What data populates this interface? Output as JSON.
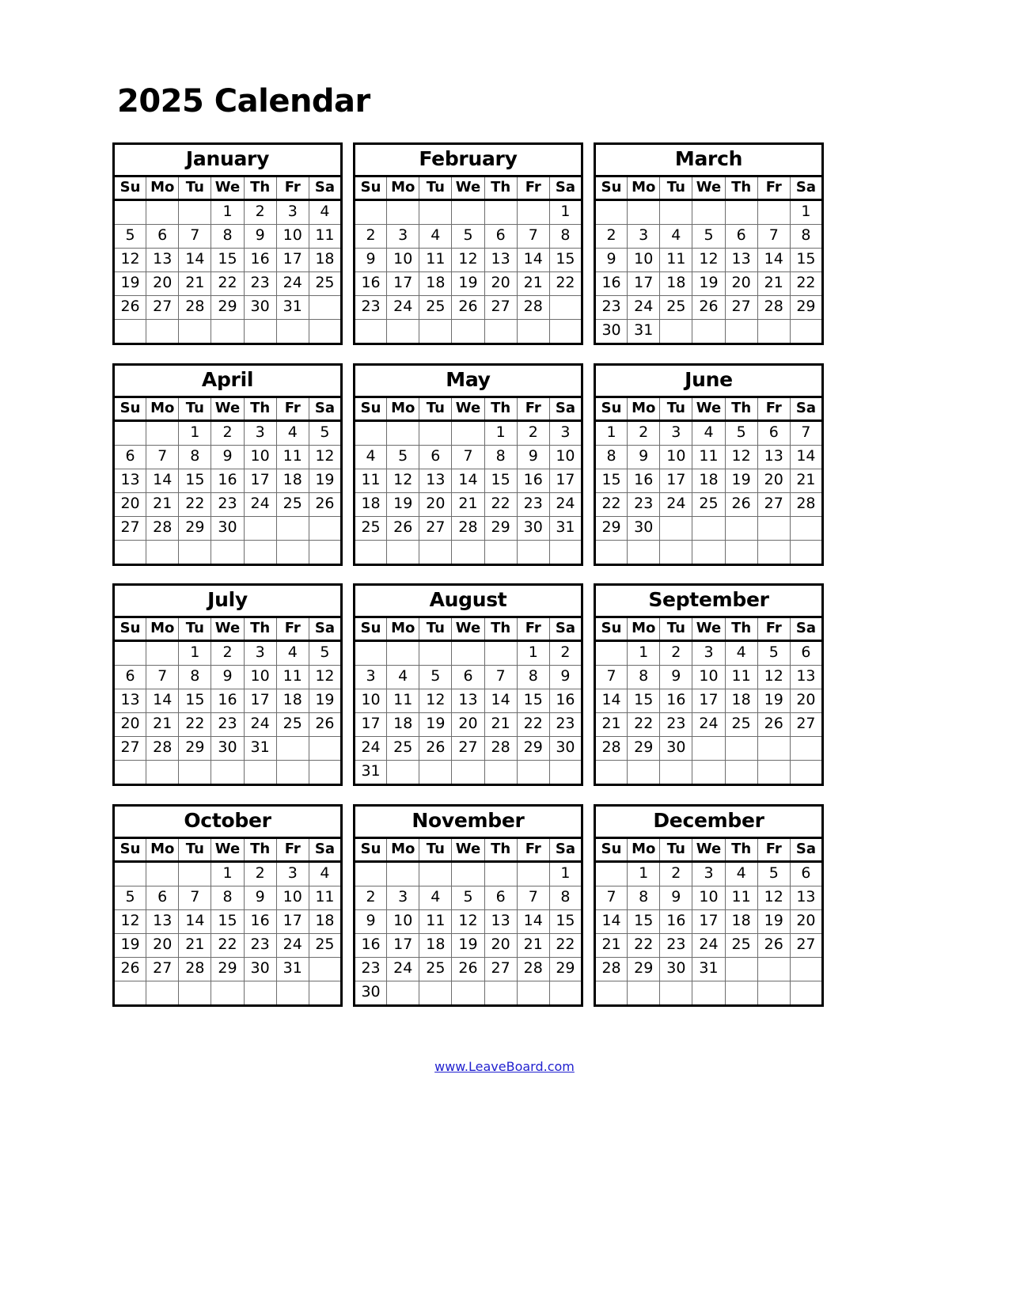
{
  "title": "2025 Calendar",
  "year": 2025,
  "footer": {
    "link_text": "www.LeaveBoard.com"
  },
  "colors": {
    "link": "#2121cf",
    "border_outer": "#000000",
    "border_inner": "#6d6d6d",
    "text": "#000000",
    "background": "#ffffff"
  },
  "weekday_headers": [
    "Su",
    "Mo",
    "Tu",
    "We",
    "Th",
    "Fr",
    "Sa"
  ],
  "months": [
    {
      "name": "January",
      "weeks": [
        [
          "",
          "",
          "",
          "1",
          "2",
          "3",
          "4"
        ],
        [
          "5",
          "6",
          "7",
          "8",
          "9",
          "10",
          "11"
        ],
        [
          "12",
          "13",
          "14",
          "15",
          "16",
          "17",
          "18"
        ],
        [
          "19",
          "20",
          "21",
          "22",
          "23",
          "24",
          "25"
        ],
        [
          "26",
          "27",
          "28",
          "29",
          "30",
          "31",
          ""
        ],
        [
          "",
          "",
          "",
          "",
          "",
          "",
          ""
        ]
      ]
    },
    {
      "name": "February",
      "weeks": [
        [
          "",
          "",
          "",
          "",
          "",
          "",
          "1"
        ],
        [
          "2",
          "3",
          "4",
          "5",
          "6",
          "7",
          "8"
        ],
        [
          "9",
          "10",
          "11",
          "12",
          "13",
          "14",
          "15"
        ],
        [
          "16",
          "17",
          "18",
          "19",
          "20",
          "21",
          "22"
        ],
        [
          "23",
          "24",
          "25",
          "26",
          "27",
          "28",
          ""
        ],
        [
          "",
          "",
          "",
          "",
          "",
          "",
          ""
        ]
      ]
    },
    {
      "name": "March",
      "weeks": [
        [
          "",
          "",
          "",
          "",
          "",
          "",
          "1"
        ],
        [
          "2",
          "3",
          "4",
          "5",
          "6",
          "7",
          "8"
        ],
        [
          "9",
          "10",
          "11",
          "12",
          "13",
          "14",
          "15"
        ],
        [
          "16",
          "17",
          "18",
          "19",
          "20",
          "21",
          "22"
        ],
        [
          "23",
          "24",
          "25",
          "26",
          "27",
          "28",
          "29"
        ],
        [
          "30",
          "31",
          "",
          "",
          "",
          "",
          ""
        ]
      ]
    },
    {
      "name": "April",
      "weeks": [
        [
          "",
          "",
          "1",
          "2",
          "3",
          "4",
          "5"
        ],
        [
          "6",
          "7",
          "8",
          "9",
          "10",
          "11",
          "12"
        ],
        [
          "13",
          "14",
          "15",
          "16",
          "17",
          "18",
          "19"
        ],
        [
          "20",
          "21",
          "22",
          "23",
          "24",
          "25",
          "26"
        ],
        [
          "27",
          "28",
          "29",
          "30",
          "",
          "",
          ""
        ],
        [
          "",
          "",
          "",
          "",
          "",
          "",
          ""
        ]
      ]
    },
    {
      "name": "May",
      "weeks": [
        [
          "",
          "",
          "",
          "",
          "1",
          "2",
          "3"
        ],
        [
          "4",
          "5",
          "6",
          "7",
          "8",
          "9",
          "10"
        ],
        [
          "11",
          "12",
          "13",
          "14",
          "15",
          "16",
          "17"
        ],
        [
          "18",
          "19",
          "20",
          "21",
          "22",
          "23",
          "24"
        ],
        [
          "25",
          "26",
          "27",
          "28",
          "29",
          "30",
          "31"
        ],
        [
          "",
          "",
          "",
          "",
          "",
          "",
          ""
        ]
      ]
    },
    {
      "name": "June",
      "weeks": [
        [
          "1",
          "2",
          "3",
          "4",
          "5",
          "6",
          "7"
        ],
        [
          "8",
          "9",
          "10",
          "11",
          "12",
          "13",
          "14"
        ],
        [
          "15",
          "16",
          "17",
          "18",
          "19",
          "20",
          "21"
        ],
        [
          "22",
          "23",
          "24",
          "25",
          "26",
          "27",
          "28"
        ],
        [
          "29",
          "30",
          "",
          "",
          "",
          "",
          ""
        ],
        [
          "",
          "",
          "",
          "",
          "",
          "",
          ""
        ]
      ]
    },
    {
      "name": "July",
      "weeks": [
        [
          "",
          "",
          "1",
          "2",
          "3",
          "4",
          "5"
        ],
        [
          "6",
          "7",
          "8",
          "9",
          "10",
          "11",
          "12"
        ],
        [
          "13",
          "14",
          "15",
          "16",
          "17",
          "18",
          "19"
        ],
        [
          "20",
          "21",
          "22",
          "23",
          "24",
          "25",
          "26"
        ],
        [
          "27",
          "28",
          "29",
          "30",
          "31",
          "",
          ""
        ],
        [
          "",
          "",
          "",
          "",
          "",
          "",
          ""
        ]
      ]
    },
    {
      "name": "August",
      "weeks": [
        [
          "",
          "",
          "",
          "",
          "",
          "1",
          "2"
        ],
        [
          "3",
          "4",
          "5",
          "6",
          "7",
          "8",
          "9"
        ],
        [
          "10",
          "11",
          "12",
          "13",
          "14",
          "15",
          "16"
        ],
        [
          "17",
          "18",
          "19",
          "20",
          "21",
          "22",
          "23"
        ],
        [
          "24",
          "25",
          "26",
          "27",
          "28",
          "29",
          "30"
        ],
        [
          "31",
          "",
          "",
          "",
          "",
          "",
          ""
        ]
      ]
    },
    {
      "name": "September",
      "weeks": [
        [
          "",
          "1",
          "2",
          "3",
          "4",
          "5",
          "6"
        ],
        [
          "7",
          "8",
          "9",
          "10",
          "11",
          "12",
          "13"
        ],
        [
          "14",
          "15",
          "16",
          "17",
          "18",
          "19",
          "20"
        ],
        [
          "21",
          "22",
          "23",
          "24",
          "25",
          "26",
          "27"
        ],
        [
          "28",
          "29",
          "30",
          "",
          "",
          "",
          ""
        ],
        [
          "",
          "",
          "",
          "",
          "",
          "",
          ""
        ]
      ]
    },
    {
      "name": "October",
      "weeks": [
        [
          "",
          "",
          "",
          "1",
          "2",
          "3",
          "4"
        ],
        [
          "5",
          "6",
          "7",
          "8",
          "9",
          "10",
          "11"
        ],
        [
          "12",
          "13",
          "14",
          "15",
          "16",
          "17",
          "18"
        ],
        [
          "19",
          "20",
          "21",
          "22",
          "23",
          "24",
          "25"
        ],
        [
          "26",
          "27",
          "28",
          "29",
          "30",
          "31",
          ""
        ],
        [
          "",
          "",
          "",
          "",
          "",
          "",
          ""
        ]
      ]
    },
    {
      "name": "November",
      "weeks": [
        [
          "",
          "",
          "",
          "",
          "",
          "",
          "1"
        ],
        [
          "2",
          "3",
          "4",
          "5",
          "6",
          "7",
          "8"
        ],
        [
          "9",
          "10",
          "11",
          "12",
          "13",
          "14",
          "15"
        ],
        [
          "16",
          "17",
          "18",
          "19",
          "20",
          "21",
          "22"
        ],
        [
          "23",
          "24",
          "25",
          "26",
          "27",
          "28",
          "29"
        ],
        [
          "30",
          "",
          "",
          "",
          "",
          "",
          ""
        ]
      ]
    },
    {
      "name": "December",
      "weeks": [
        [
          "",
          "1",
          "2",
          "3",
          "4",
          "5",
          "6"
        ],
        [
          "7",
          "8",
          "9",
          "10",
          "11",
          "12",
          "13"
        ],
        [
          "14",
          "15",
          "16",
          "17",
          "18",
          "19",
          "20"
        ],
        [
          "21",
          "22",
          "23",
          "24",
          "25",
          "26",
          "27"
        ],
        [
          "28",
          "29",
          "30",
          "31",
          "",
          "",
          ""
        ],
        [
          "",
          "",
          "",
          "",
          "",
          "",
          ""
        ]
      ]
    }
  ]
}
